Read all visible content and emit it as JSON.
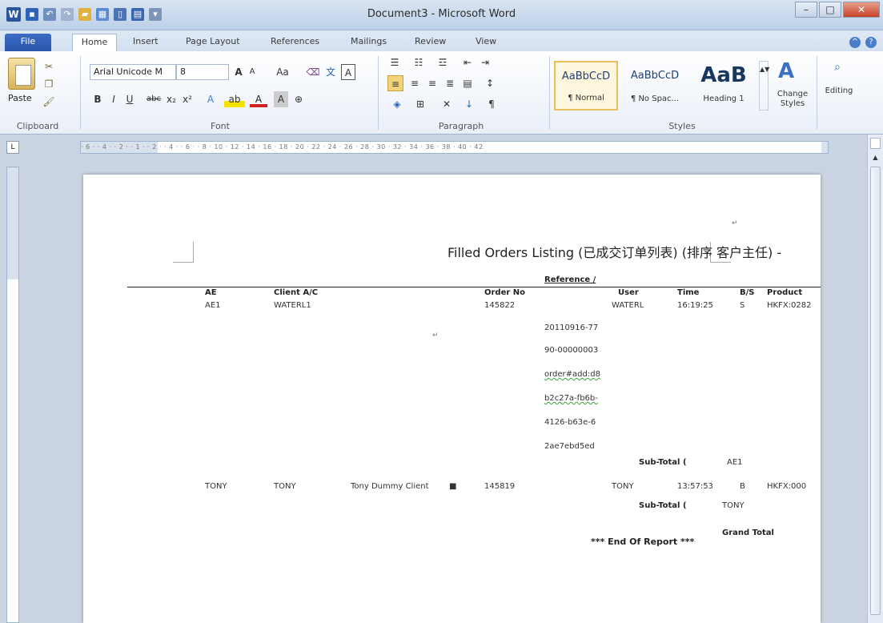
{
  "window": {
    "title": "Document3 - Microsoft Word"
  },
  "tabs": [
    "File",
    "Home",
    "Insert",
    "Page Layout",
    "References",
    "Mailings",
    "Review",
    "View"
  ],
  "ribbon": {
    "clipboard": {
      "paste_label": "Paste",
      "group_label": "Clipboard"
    },
    "font": {
      "font_name": "Arial Unicode M",
      "font_size": "8",
      "group_label": "Font",
      "bold": "B",
      "italic": "I",
      "underline": "U",
      "strike": "abc",
      "sub": "x₂",
      "sup": "x²",
      "grow": "A",
      "shrink": "A",
      "case": "Aa"
    },
    "paragraph": {
      "group_label": "Paragraph"
    },
    "styles": {
      "group_label": "Styles",
      "items": [
        {
          "sample": "AaBbCcD",
          "name": "¶ Normal"
        },
        {
          "sample": "AaBbCcD",
          "name": "¶ No Spac..."
        },
        {
          "sample": "AaB",
          "name": "Heading 1"
        }
      ],
      "change_styles": "Change Styles"
    },
    "editing": {
      "label": "Editing"
    }
  },
  "ruler": {
    "marks": "· 6 · · 4 · · 2 · · 1 · · 2 · · 4 · · 6 · · 8 · 10 · 12 · 14 · 16 · 18 · 20 · 22 · 24 · 26 · 28 · 30 · 32 · 34 · 36 · 38 · 40 · 42"
  },
  "document": {
    "title": "Filled Orders Listing (已成交订单列表) (排序  客户主任)  -",
    "reference_header": "Reference /",
    "columns": [
      "AE",
      "Client A/C",
      "Order No",
      "User",
      "Time",
      "B/S",
      "Product"
    ],
    "row1": {
      "ae": "AE1",
      "client": "WATERL1",
      "order": "145822",
      "user": "WATERL",
      "time": "16:19:25",
      "bs": "S",
      "product": "HKFX:0282"
    },
    "reference_lines": [
      "20110916-77",
      "90-00000003",
      "order#add:d8",
      "b2c27a-fb6b-",
      "4126-b63e-6",
      "2ae7ebd5ed"
    ],
    "subtotal1": {
      "label": "Sub-Total (",
      "value": "AE1"
    },
    "row2": {
      "ae": "TONY",
      "client": "TONY",
      "name": "Tony Dummy Client",
      "flag": "■",
      "order": "145819",
      "user": "TONY",
      "time": "13:57:53",
      "bs": "B",
      "product": "HKFX:000"
    },
    "subtotal2": {
      "label": "Sub-Total (",
      "value": "TONY"
    },
    "grand_total": "Grand Total",
    "end_of_report": "*** End Of Report ***"
  }
}
